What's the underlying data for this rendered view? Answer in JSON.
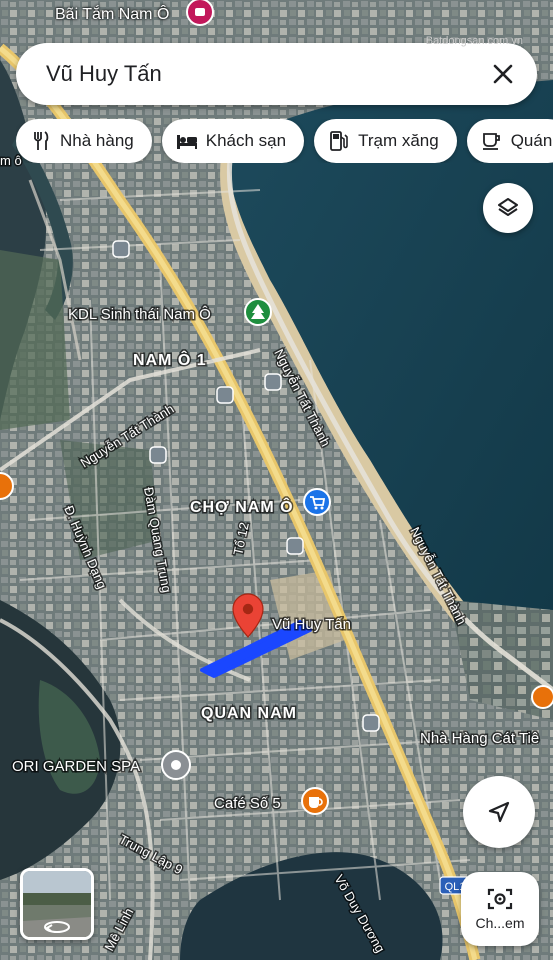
{
  "top_label": "Bãi Tắm Nam Ô",
  "search": {
    "query": "Vũ Huy Tấn"
  },
  "watermark": "Batdongsan.com.vn",
  "chips": [
    {
      "label": "Nhà hàng",
      "icon": "restaurant-icon"
    },
    {
      "label": "Khách sạn",
      "icon": "hotel-icon"
    },
    {
      "label": "Trạm xăng",
      "icon": "gas-station-icon"
    },
    {
      "label": "Quán",
      "icon": "coffee-icon"
    }
  ],
  "map_labels": {
    "kdl": "KDL Sinh thái Nam Ô",
    "nam_o_1": "NAM Ô 1",
    "nguyen_tat_thanh_a": "Nguyễn Tất Thành",
    "nguyen_tat_thanh_b": "Nguyễn Tất Thành",
    "nguyen_tat_thanh_c": "Nguyễn Tất Thành",
    "cho_nam_o": "CHỢ NAM Ô",
    "huynh_dang": "Đ. Huỳnh Dạng",
    "dam_quang_trung": "Đàm Quang Trung",
    "to_12": "Tổ 12",
    "selected": "Vũ Huy Tấn",
    "quan_nam": "QUAN NAM",
    "nha_hang": "Nhà Hàng Cát Tiê",
    "ori": "ORI GARDEN SPA",
    "cafe": "Café Số 5",
    "trung_lap": "Trung Lập 9",
    "vo_duy_duong": "Võ Duy Dương",
    "me_linh": "Mê Linh",
    "ql1": "QL1",
    "left_fragment": "m ô"
  },
  "screenshot_fab": {
    "label": "Ch...em"
  },
  "colors": {
    "selected_road": "#1a47ff",
    "pin": "#ea4335",
    "accent": "#1a73e8"
  }
}
